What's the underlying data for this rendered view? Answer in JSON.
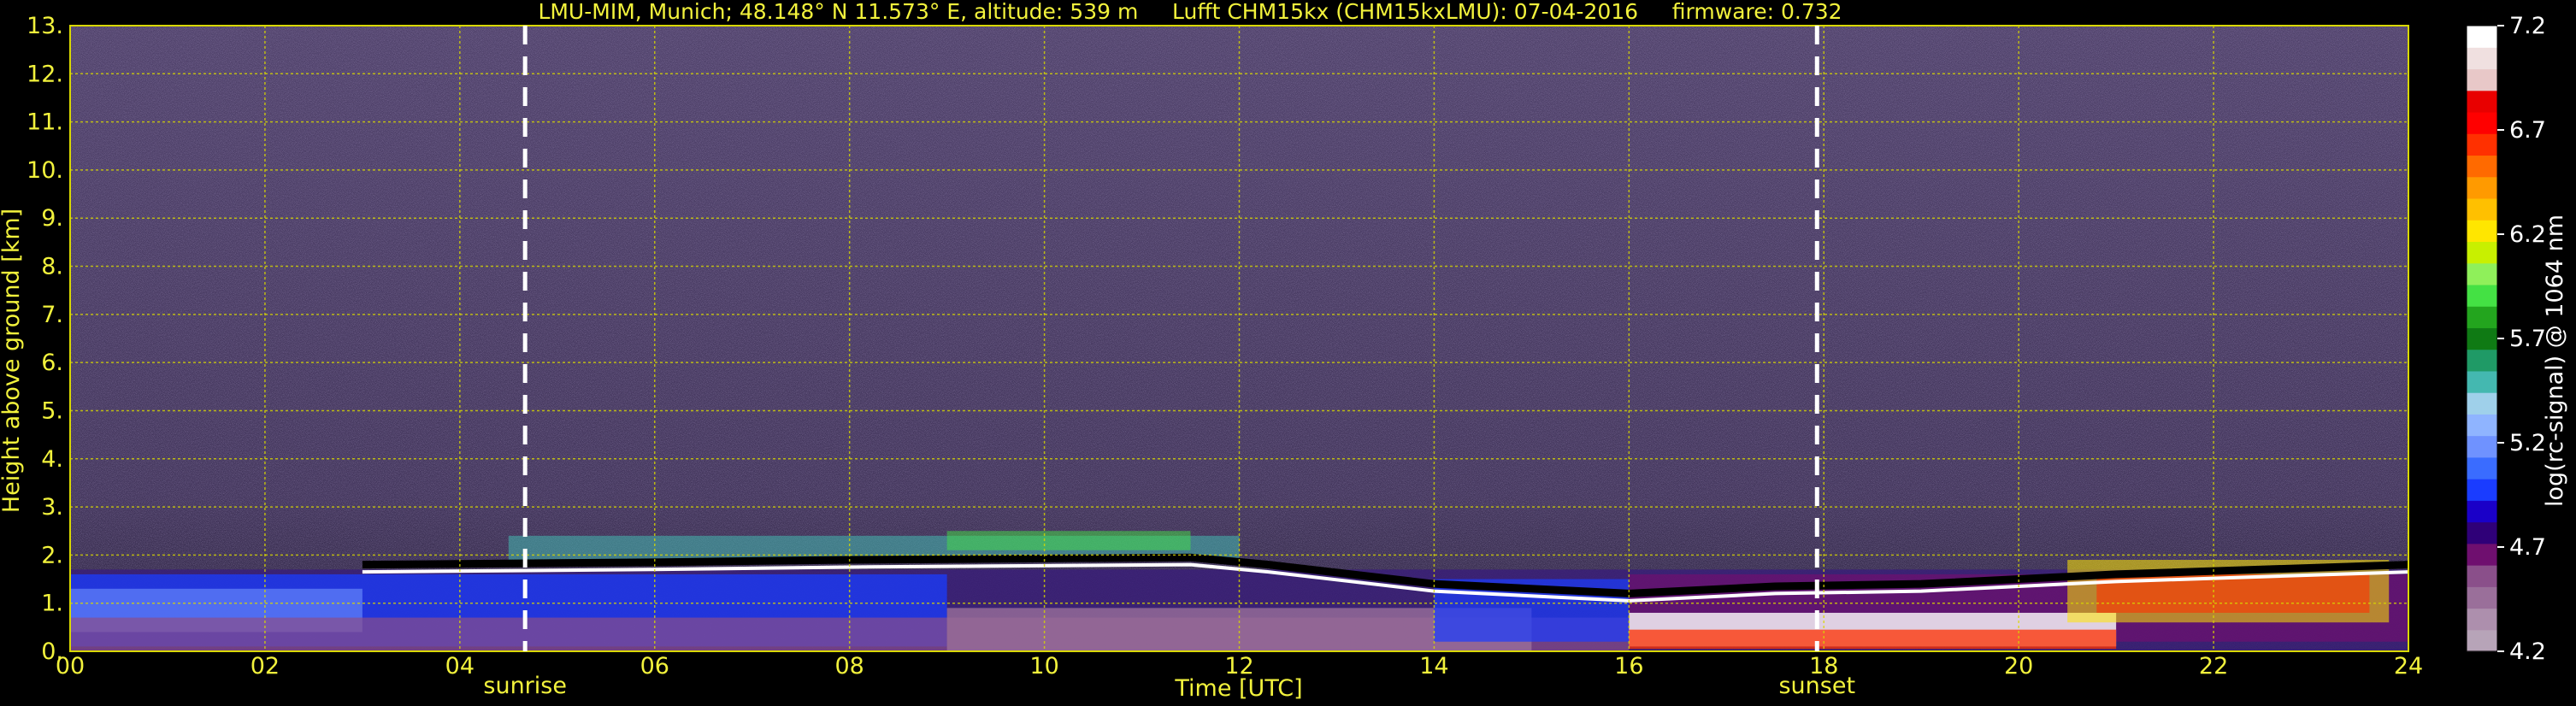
{
  "chart_data": {
    "type": "heatmap",
    "title": "LMU-MIM, Munich; 48.148° N 11.573° E, altitude: 539 m     Lufft CHM15kx (CHM15kxLMU): 07-04-2016     firmware: 0.732",
    "xlabel": "Time [UTC]",
    "ylabel": "Height above ground [km]",
    "xlim": [
      0,
      24
    ],
    "ylim": [
      0,
      13
    ],
    "x_ticks": [
      "00",
      "02",
      "04",
      "06",
      "08",
      "10",
      "12",
      "14",
      "16",
      "18",
      "20",
      "22",
      "24"
    ],
    "y_ticks": [
      "0.",
      "1.",
      "2.",
      "3.",
      "4.",
      "5.",
      "6.",
      "7.",
      "8.",
      "9.",
      "10.",
      "11.",
      "12.",
      "13."
    ],
    "grid": true,
    "markers": [
      {
        "label": "sunrise",
        "x": 4.67
      },
      {
        "label": "sunset",
        "x": 17.93
      }
    ],
    "colorbar": {
      "label": "log(rc-signal) @ 1064 nm",
      "ticks": [
        "4.2",
        "4.7",
        "5.2",
        "5.7",
        "6.2",
        "6.7",
        "7.2"
      ],
      "range": [
        4.2,
        7.2
      ]
    },
    "colors": [
      "#b7a4b8",
      "#ad8fad",
      "#9a6f9a",
      "#8a4f8a",
      "#6f0f6f",
      "#2f0078",
      "#1a00c8",
      "#1a3cff",
      "#3a6cff",
      "#6f92ff",
      "#8fb4ff",
      "#9fd0ea",
      "#44b8b0",
      "#1f9a66",
      "#0f7a14",
      "#23a51e",
      "#44e144",
      "#8ff05a",
      "#c8f000",
      "#ffe600",
      "#ffc000",
      "#ff9a00",
      "#ff6a00",
      "#ff3000",
      "#ff0000",
      "#e80000",
      "#e8c8c8",
      "#f0e0e0",
      "#ffffff"
    ],
    "layers": [
      {
        "name": "background",
        "color": "#5a4a7a"
      }
    ]
  }
}
